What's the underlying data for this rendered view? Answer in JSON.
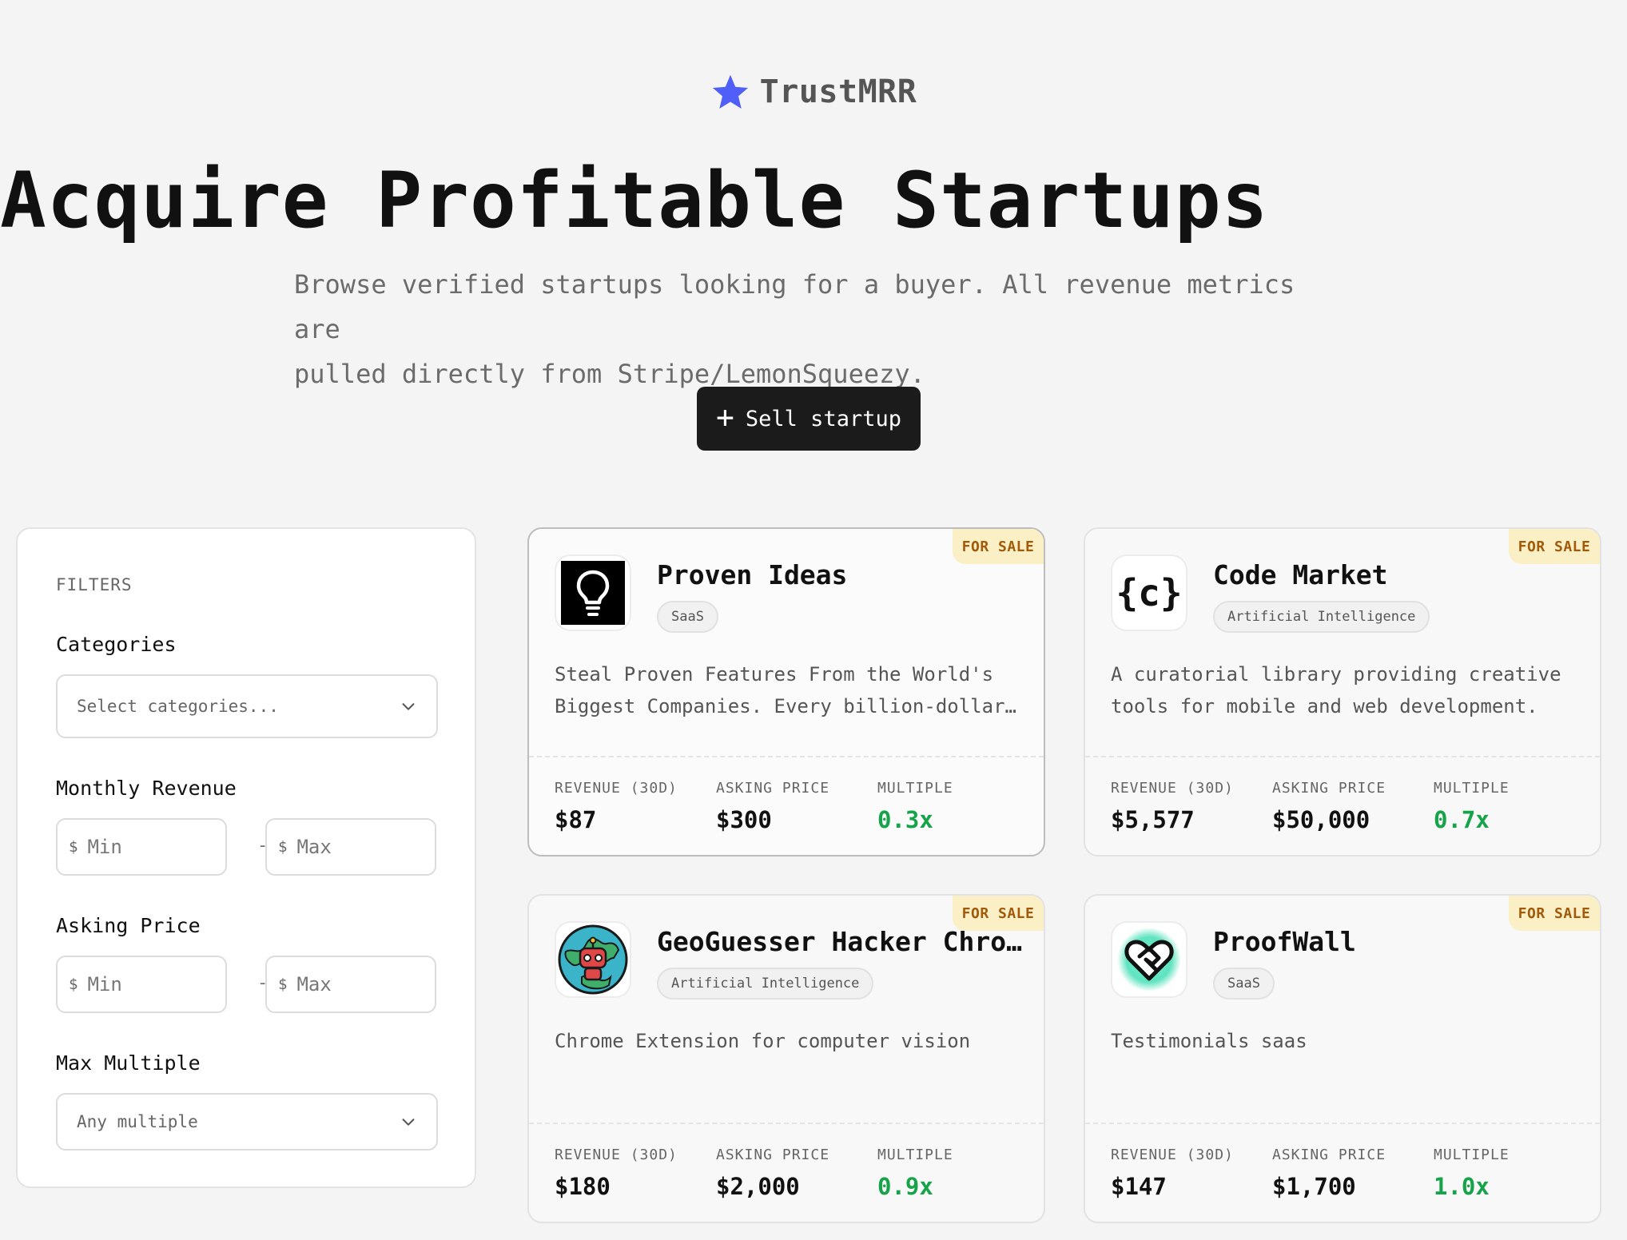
{
  "brand": {
    "name": "TrustMRR",
    "icon": "star-icon",
    "accent": "#4f5ff7"
  },
  "hero": {
    "title": "Acquire Profitable Startups",
    "subtitle_line1": "Browse verified startups looking for a buyer. All revenue metrics are",
    "subtitle_line2": "pulled directly from Stripe/LemonSqueezy.",
    "cta_label": "Sell startup"
  },
  "filters": {
    "heading": "FILTERS",
    "categories_label": "Categories",
    "categories_placeholder": "Select categories...",
    "monthly_revenue_label": "Monthly Revenue",
    "asking_price_label": "Asking Price",
    "max_multiple_label": "Max Multiple",
    "max_multiple_value": "Any multiple",
    "currency_symbol": "$",
    "min_placeholder": "Min",
    "max_placeholder": "Max",
    "range_separator": "-"
  },
  "metric_labels": {
    "revenue": "REVENUE (30D)",
    "asking": "ASKING PRICE",
    "multiple": "MULTIPLE"
  },
  "status_color": "#16a34a",
  "listings": [
    {
      "badge": "FOR SALE",
      "name": "Proven Ideas",
      "category": "SaaS",
      "description": "Steal Proven Features From the World's Biggest Companies. Every billion-dollar company started somewhere.",
      "revenue": "$87",
      "asking_price": "$300",
      "multiple": "0.3x",
      "logo_icon": "lightbulb-icon"
    },
    {
      "badge": "FOR SALE",
      "name": "Code Market",
      "category": "Artificial Intelligence",
      "description": "A curatorial library providing creative tools for mobile and web development.",
      "revenue": "$5,577",
      "asking_price": "$50,000",
      "multiple": "0.7x",
      "logo_text": "{c}",
      "logo_icon": "curly-braces-c-icon"
    },
    {
      "badge": "FOR SALE",
      "name": "GeoGuesser Hacker Chrome…",
      "category": "Artificial Intelligence",
      "description": "Chrome Extension for computer vision",
      "revenue": "$180",
      "asking_price": "$2,000",
      "multiple": "0.9x",
      "logo_icon": "robot-globe-icon"
    },
    {
      "badge": "FOR SALE",
      "name": "ProofWall",
      "category": "SaaS",
      "description": "Testimonials saas",
      "revenue": "$147",
      "asking_price": "$1,700",
      "multiple": "1.0x",
      "logo_icon": "heart-handshake-icon"
    }
  ]
}
